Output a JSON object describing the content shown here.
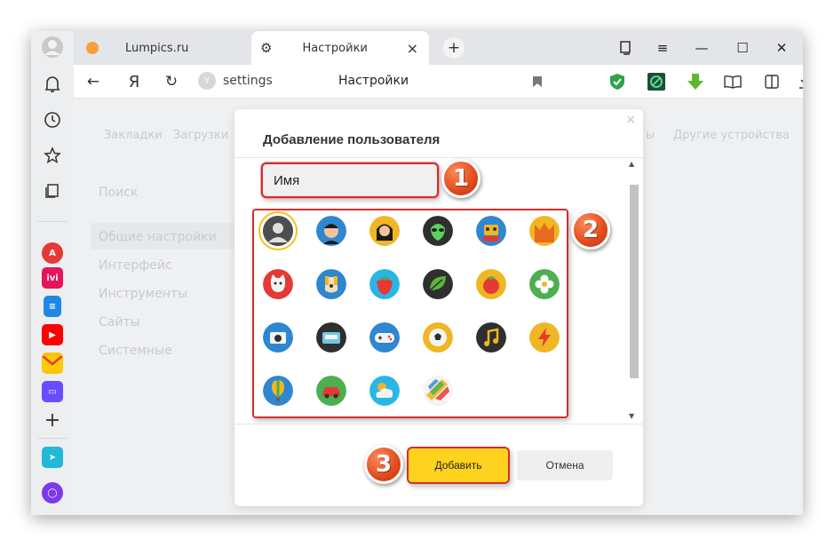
{
  "tabs": [
    {
      "label": "Lumpics.ru",
      "icon": "orange-circle-icon"
    },
    {
      "label": "Настройки",
      "icon": "gear-icon",
      "close": "×"
    }
  ],
  "new_tab": "+",
  "window_controls": {
    "minimize": "—",
    "maximize": "☐",
    "close": "✕"
  },
  "nav": {
    "back": "←",
    "logo": "Я",
    "reload": "↻",
    "address": "settings",
    "page_title": "Настройки"
  },
  "settings_bg": {
    "top_links": [
      "Закладки",
      "Загрузки",
      "ы",
      "Другие устройства"
    ],
    "search": "Поиск",
    "menu": [
      "Общие настройки",
      "Интерфейс",
      "Инструменты",
      "Сайты",
      "Системные"
    ]
  },
  "dialog": {
    "title": "Добавление пользователя",
    "close": "×",
    "name_value": "Имя",
    "add_label": "Добавить",
    "cancel_label": "Отмена",
    "scroll_up": "▲",
    "scroll_down": "▼"
  },
  "avatars": [
    "default-person-avatar",
    "man-avatar",
    "woman-avatar",
    "alien-avatar",
    "robot-avatar",
    "fox-avatar",
    "cat-avatar",
    "dog-avatar",
    "strawberry-avatar",
    "leaf-avatar",
    "tomato-avatar",
    "flower-avatar",
    "camera-avatar",
    "cassette-avatar",
    "gamepad-avatar",
    "soccer-ball-avatar",
    "music-note-avatar",
    "lightning-avatar",
    "hot-air-balloon-avatar",
    "car-avatar",
    "cloud-avatar",
    "abstract-avatar"
  ],
  "badges": [
    "1",
    "2",
    "3"
  ],
  "colors": {
    "accent_yellow": "#ffd21d",
    "highlight_red": "#d32f2f",
    "badge_orange": "#e04a1b"
  }
}
